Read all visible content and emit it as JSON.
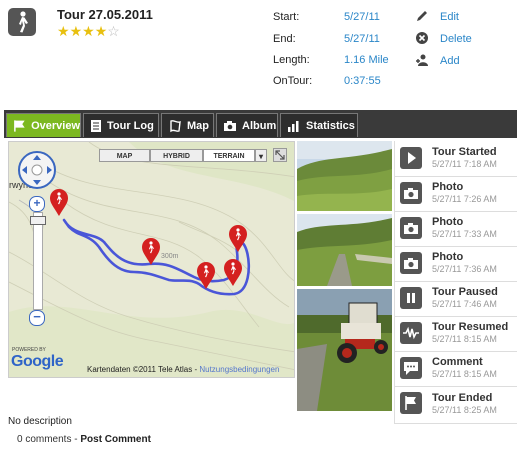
{
  "header": {
    "title": "Tour 27.05.2011",
    "rating": 4,
    "rating_max": 5
  },
  "details": [
    {
      "label": "Start:",
      "value": "5/27/11"
    },
    {
      "label": "End:",
      "value": "5/27/11"
    },
    {
      "label": "Length:",
      "value": "1.16 Mile"
    },
    {
      "label": "OnTour:",
      "value": "0:37:55"
    }
  ],
  "actions": {
    "edit": "Edit",
    "delete": "Delete",
    "add": "Add"
  },
  "tabs": [
    {
      "label": "Overview",
      "icon": "flag-icon",
      "active": true
    },
    {
      "label": "Tour Log",
      "icon": "document-icon",
      "active": false
    },
    {
      "label": "Map",
      "icon": "map-icon",
      "active": false
    },
    {
      "label": "Album",
      "icon": "camera-icon",
      "active": false
    },
    {
      "label": "Statistics",
      "icon": "bar-chart-icon",
      "active": false
    }
  ],
  "map": {
    "type_buttons": [
      "MAP",
      "HYBRID",
      "TERRAIN"
    ],
    "selected_type": "TERRAIN",
    "place_label": "rwyno",
    "contour_label": "300m",
    "powered_by": "POWERED BY",
    "brand": "Google",
    "attribution": "Kartendaten ©2011 Tele Atlas",
    "terms_link": "Nutzungsbedingungen",
    "colors": {
      "route": "#4a56d8",
      "marker": "#d42020"
    }
  },
  "timeline": [
    {
      "title": "Tour Started",
      "time": "5/27/11 7:18 AM",
      "icon": "play-icon"
    },
    {
      "title": "Photo",
      "time": "5/27/11 7:26 AM",
      "icon": "camera-icon"
    },
    {
      "title": "Photo",
      "time": "5/27/11 7:33 AM",
      "icon": "camera-icon"
    },
    {
      "title": "Photo",
      "time": "5/27/11 7:36 AM",
      "icon": "camera-icon"
    },
    {
      "title": "Tour Paused",
      "time": "5/27/11 7:46 AM",
      "icon": "pause-icon"
    },
    {
      "title": "Tour Resumed",
      "time": "5/27/11 8:15 AM",
      "icon": "wave-icon"
    },
    {
      "title": "Comment",
      "time": "5/27/11 8:15 AM",
      "icon": "speech-bubble-icon"
    },
    {
      "title": "Tour Ended",
      "time": "5/27/11 8:25 AM",
      "icon": "flag-icon"
    }
  ],
  "description": "No description",
  "comments": {
    "count": "0 comments",
    "separator": " - ",
    "post": "Post Comment"
  }
}
